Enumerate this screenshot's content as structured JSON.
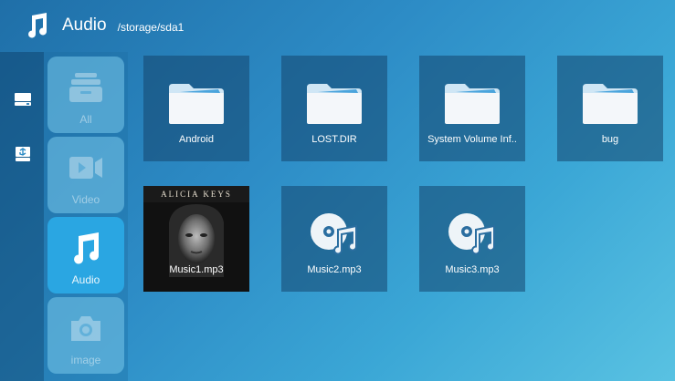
{
  "header": {
    "icon": "music-note-icon",
    "title": "Audio",
    "path": "/storage/sda1"
  },
  "devices": [
    {
      "icon": "drive-icon"
    },
    {
      "icon": "usb-drive-icon"
    }
  ],
  "categories": [
    {
      "label": "All",
      "icon": "all-files-icon",
      "active": false
    },
    {
      "label": "Video",
      "icon": "video-camera-icon",
      "active": false
    },
    {
      "label": "Audio",
      "icon": "music-note-icon",
      "active": true
    },
    {
      "label": "image",
      "icon": "camera-icon",
      "active": false
    }
  ],
  "files": [
    {
      "name": "Android",
      "type": "folder",
      "icon": "folder-icon"
    },
    {
      "name": "LOST.DIR",
      "type": "folder",
      "icon": "folder-icon"
    },
    {
      "name": "System Volume Inf..",
      "type": "folder",
      "icon": "folder-icon"
    },
    {
      "name": "bug",
      "type": "folder",
      "icon": "folder-icon"
    },
    {
      "name": "Music1.mp3",
      "type": "audio",
      "icon": "album-cover",
      "cover_text": "ALICIA KEYS"
    },
    {
      "name": "Music2.mp3",
      "type": "audio",
      "icon": "music-disc-icon"
    },
    {
      "name": "Music3.mp3",
      "type": "audio",
      "icon": "music-disc-icon"
    }
  ],
  "colors": {
    "accent": "#2aa6e2",
    "background_start": "#1f6fa8",
    "background_end": "#59c2e2",
    "tile": "#1e4a6e"
  }
}
